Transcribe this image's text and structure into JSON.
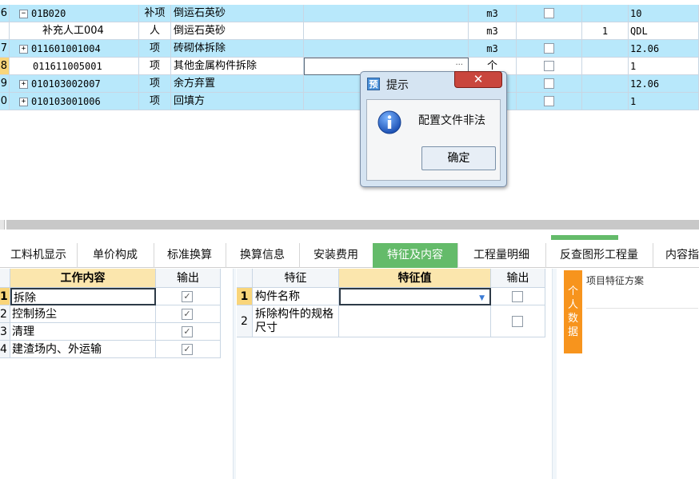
{
  "top_grid": {
    "rows": [
      {
        "num": "6",
        "expander": "−",
        "code": "01B020",
        "type": "补项",
        "name": "倒运石英砂",
        "unit": "m3",
        "checked": false,
        "qty": "",
        "value": "10",
        "style": "blue"
      },
      {
        "num": "",
        "expander": "",
        "code": "补充人工004",
        "type": "人",
        "name": "倒运石英砂",
        "unit": "m3",
        "checked": null,
        "qty": "1",
        "value": "QDL",
        "style": "white"
      },
      {
        "num": "7",
        "expander": "+",
        "code": "011601001004",
        "type": "项",
        "name": "砖砌体拆除",
        "unit": "m3",
        "checked": false,
        "qty": "",
        "value": "12.06",
        "style": "blue"
      },
      {
        "num": "8",
        "expander": "",
        "code": "011611005001",
        "type": "项",
        "name": "其他金属构件拆除",
        "unit": "个",
        "checked": false,
        "qty": "",
        "value": "1",
        "style": "white"
      },
      {
        "num": "9",
        "expander": "+",
        "code": "010103002007",
        "type": "项",
        "name": "余方弃置",
        "unit": "",
        "checked": false,
        "qty": "",
        "value": "12.06",
        "style": "blue"
      },
      {
        "num": "0",
        "expander": "+",
        "code": "010103001006",
        "type": "项",
        "name": "回填方",
        "unit": "",
        "checked": false,
        "qty": "",
        "value": "1",
        "style": "blue"
      }
    ],
    "ellipsis": "···"
  },
  "tabs": [
    {
      "label": "工料机显示",
      "active": false
    },
    {
      "label": "单价构成",
      "active": false
    },
    {
      "label": "标准换算",
      "active": false
    },
    {
      "label": "换算信息",
      "active": false
    },
    {
      "label": "安装费用",
      "active": false
    },
    {
      "label": "特征及内容",
      "active": true
    },
    {
      "label": "工程量明细",
      "active": false
    },
    {
      "label": "反查图形工程量",
      "active": false
    },
    {
      "label": "内容指",
      "active": false
    }
  ],
  "work_table": {
    "header_content": "工作内容",
    "header_output": "输出",
    "rows": [
      {
        "num": "1",
        "label": "拆除",
        "checked": true
      },
      {
        "num": "2",
        "label": "控制扬尘",
        "checked": true
      },
      {
        "num": "3",
        "label": "清理",
        "checked": true
      },
      {
        "num": "4",
        "label": "建渣场内、外运输",
        "checked": true
      }
    ]
  },
  "feature_table": {
    "header_feature": "特征",
    "header_value": "特征值",
    "header_output": "输出",
    "rows": [
      {
        "num": "1",
        "label": "构件名称",
        "value": "",
        "checked": false
      },
      {
        "num": "2",
        "label": "拆除构件的规格尺寸",
        "value": "",
        "checked": false
      }
    ]
  },
  "scheme_panel": {
    "title": "项目特征方案",
    "side_tab": "个人数据"
  },
  "dialog": {
    "app_icon_text": "预",
    "title": "提示",
    "message": "配置文件非法",
    "ok_label": "确定",
    "close_label": "✕"
  }
}
